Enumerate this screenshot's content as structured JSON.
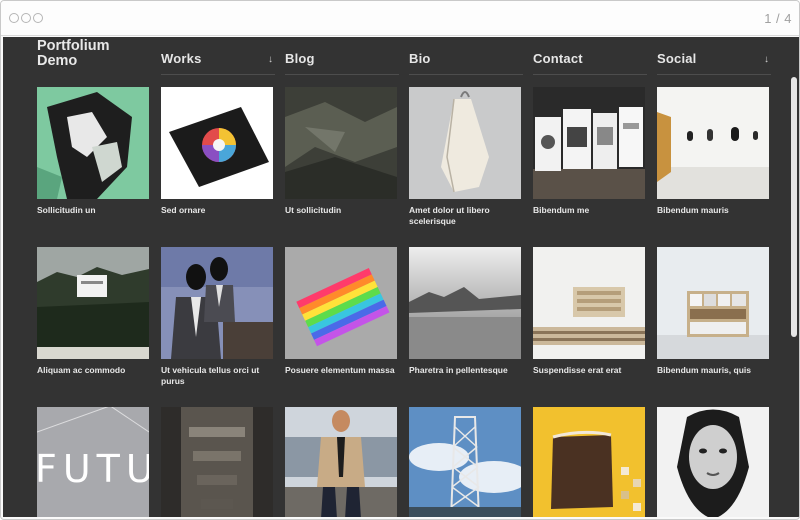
{
  "browser": {
    "page_counter": "1 / 4"
  },
  "site": {
    "logo_line1": "Portfolium",
    "logo_line2": "Demo",
    "nav": [
      {
        "label": "Works",
        "has_dropdown": true
      },
      {
        "label": "Blog",
        "has_dropdown": false
      },
      {
        "label": "Bio",
        "has_dropdown": false
      },
      {
        "label": "Contact",
        "has_dropdown": false
      },
      {
        "label": "Social",
        "has_dropdown": true
      }
    ],
    "dropdown_icon": "arrow-down-icon",
    "colors": {
      "background": "#333333",
      "text": "#e8e8e8",
      "divider": "#4d4d4d"
    }
  },
  "grid": {
    "items": [
      {
        "caption": "Sollicitudin un"
      },
      {
        "caption": "Sed ornare"
      },
      {
        "caption": "Ut sollicitudin"
      },
      {
        "caption": "Amet dolor ut libero scelerisque"
      },
      {
        "caption": "Bibendum me"
      },
      {
        "caption": "Bibendum mauris"
      },
      {
        "caption": "Aliquam ac commodo"
      },
      {
        "caption": "Ut vehicula tellus orci ut purus"
      },
      {
        "caption": "Posuere elementum massa"
      },
      {
        "caption": "Pharetra in pellentesque"
      },
      {
        "caption": "Suspendisse erat erat"
      },
      {
        "caption": "Bibendum mauris, quis"
      },
      {
        "caption": ""
      },
      {
        "caption": ""
      },
      {
        "caption": ""
      },
      {
        "caption": ""
      },
      {
        "caption": ""
      },
      {
        "caption": ""
      }
    ],
    "tile3_text": "FUTU"
  }
}
